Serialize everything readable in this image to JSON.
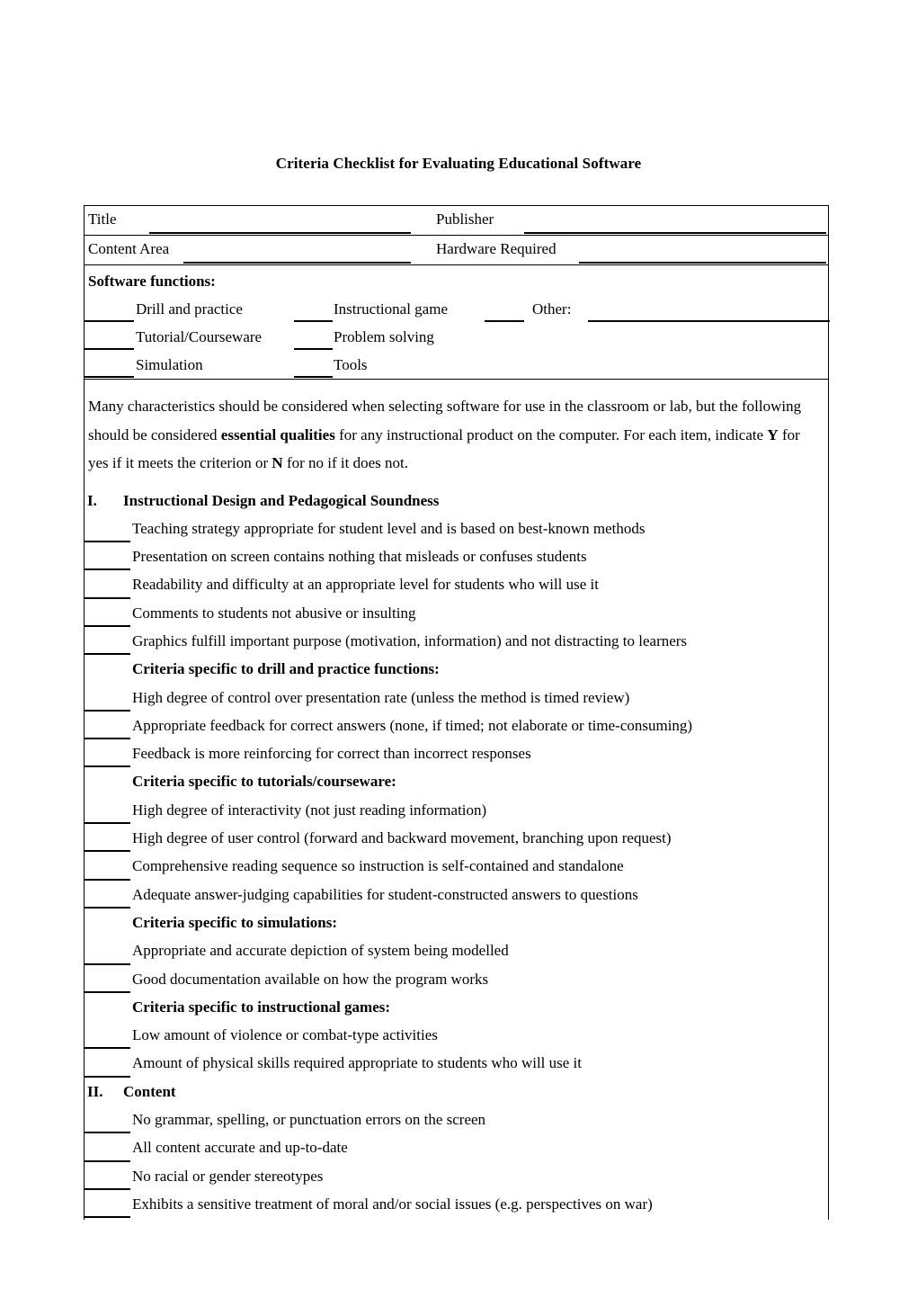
{
  "document": {
    "title": "Criteria Checklist for Evaluating Educational Software"
  },
  "header_fields": {
    "title_label": "Title",
    "publisher_label": "Publisher",
    "content_area_label": "Content Area",
    "hardware_required_label": "Hardware Required",
    "title_value": "",
    "publisher_value": "",
    "content_area_value": "",
    "hardware_required_value": ""
  },
  "software_functions": {
    "heading": "Software functions:",
    "rows": [
      {
        "left": "Drill and practice",
        "middle": "Instructional game",
        "right": "Other:"
      },
      {
        "left": "Tutorial/Courseware",
        "middle": "Problem solving",
        "right": ""
      },
      {
        "left": "Simulation",
        "middle": "Tools",
        "right": ""
      }
    ],
    "other_value": ""
  },
  "intro_paragraph": {
    "part1": "Many characteristics should be considered when selecting software for use in the classroom or lab, but the following should be considered ",
    "bold1": "essential qualities",
    "part2": " for any instructional product on the computer.  For each item, indicate ",
    "bold2": "Y",
    "part3": " for yes if it meets the criterion or ",
    "bold3": "N",
    "part4": " for no if it does not."
  },
  "sections": [
    {
      "number": "I.",
      "label": "Instructional Design and Pedagogical Soundness",
      "entries": [
        {
          "kind": "item",
          "text": "Teaching strategy appropriate for student level and is based on best-known methods"
        },
        {
          "kind": "item",
          "text": "Presentation on screen contains nothing that misleads or confuses students"
        },
        {
          "kind": "item",
          "text": "Readability and difficulty at an appropriate level for students who will use it"
        },
        {
          "kind": "item",
          "text": "Comments to students not abusive or insulting"
        },
        {
          "kind": "item",
          "text": "Graphics fulfill important purpose (motivation, information) and not distracting to learners"
        },
        {
          "kind": "subhead",
          "text": "Criteria specific to drill and practice functions:"
        },
        {
          "kind": "item",
          "text": "High degree of control over presentation rate (unless the method is timed review)"
        },
        {
          "kind": "item",
          "text": "Appropriate feedback for correct answers (none, if timed; not elaborate or time-consuming)"
        },
        {
          "kind": "item",
          "text": "Feedback is more reinforcing for correct than incorrect responses"
        },
        {
          "kind": "subhead",
          "text": "Criteria specific to tutorials/courseware:"
        },
        {
          "kind": "item",
          "text": "High degree of interactivity (not just reading information)"
        },
        {
          "kind": "item",
          "text": "High degree of user control (forward and backward movement, branching upon request)"
        },
        {
          "kind": "item",
          "text": "Comprehensive reading sequence so instruction is self-contained and standalone"
        },
        {
          "kind": "item",
          "text": "Adequate answer-judging capabilities for student-constructed answers to questions"
        },
        {
          "kind": "subhead",
          "text": "Criteria specific to simulations:"
        },
        {
          "kind": "item",
          "text": "Appropriate and accurate depiction of system being modelled"
        },
        {
          "kind": "item",
          "text": "Good documentation available on how the program works"
        },
        {
          "kind": "subhead",
          "text": "Criteria specific to instructional games:"
        },
        {
          "kind": "item",
          "text": "Low amount of violence or combat-type activities"
        },
        {
          "kind": "item",
          "text": "Amount of physical skills required appropriate to students who will use it"
        }
      ]
    },
    {
      "number": "II.",
      "label": "Content",
      "entries": [
        {
          "kind": "item",
          "text": "No grammar, spelling, or punctuation errors on the screen"
        },
        {
          "kind": "item",
          "text": "All content accurate and up-to-date"
        },
        {
          "kind": "item",
          "text": "No racial or gender stereotypes"
        },
        {
          "kind": "item",
          "text": "Exhibits a sensitive treatment of moral and/or social issues (e.g. perspectives on war)"
        }
      ]
    }
  ]
}
